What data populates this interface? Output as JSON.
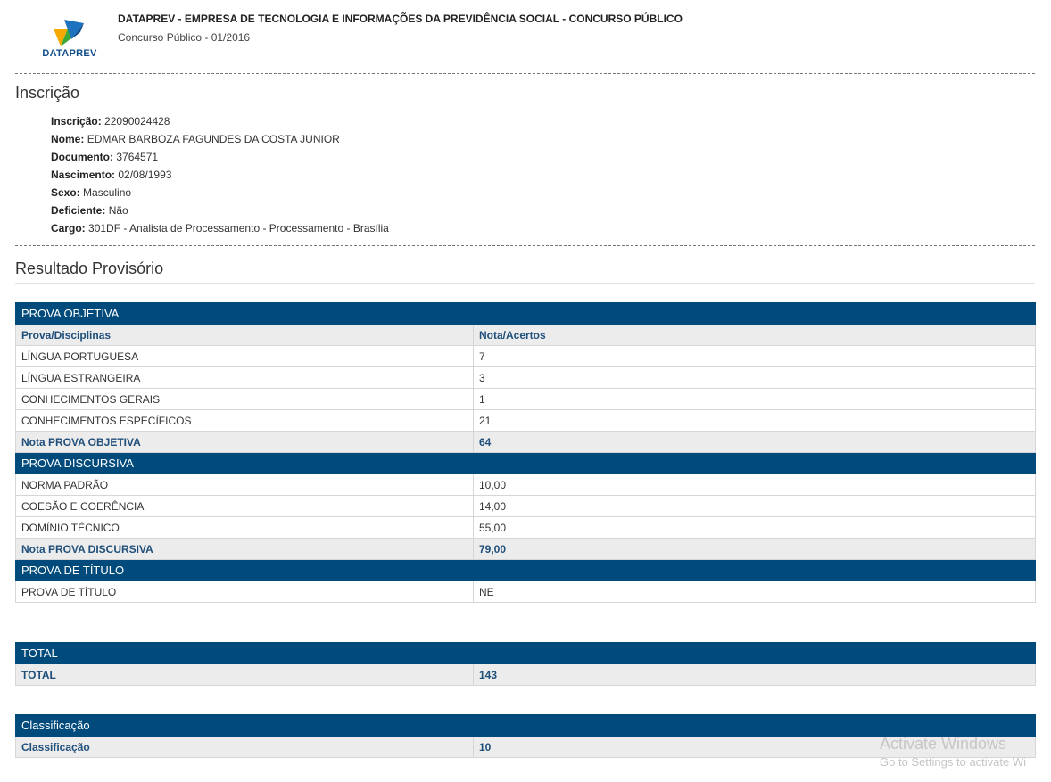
{
  "header": {
    "logo_text": "DATAPREV",
    "org_title": "DATAPREV - EMPRESA DE TECNOLOGIA E INFORMAÇÕES DA PREVIDÊNCIA SOCIAL - CONCURSO PÚBLICO",
    "org_subtitle": "Concurso Público - 01/2016"
  },
  "inscricao": {
    "title": "Inscrição",
    "fields": [
      {
        "label": "Inscrição:",
        "value": "22090024428"
      },
      {
        "label": "Nome:",
        "value": "EDMAR BARBOZA FAGUNDES DA COSTA JUNIOR"
      },
      {
        "label": "Documento:",
        "value": "3764571"
      },
      {
        "label": "Nascimento:",
        "value": "02/08/1993"
      },
      {
        "label": "Sexo:",
        "value": "Masculino"
      },
      {
        "label": "Deficiente:",
        "value": "Não"
      },
      {
        "label": "Cargo:",
        "value": "301DF - Analista de Processamento - Processamento - Brasília"
      }
    ]
  },
  "resultado": {
    "title": "Resultado Provisório",
    "objetiva": {
      "band": "PROVA OBJETIVA",
      "col1": "Prova/Disciplinas",
      "col2": "Nota/Acertos",
      "rows": [
        {
          "name": "LÍNGUA PORTUGUESA",
          "value": "7"
        },
        {
          "name": "LÍNGUA ESTRANGEIRA",
          "value": "3"
        },
        {
          "name": "CONHECIMENTOS GERAIS",
          "value": "1"
        },
        {
          "name": "CONHECIMENTOS ESPECÍFICOS",
          "value": "21"
        }
      ],
      "total_label": "Nota PROVA OBJETIVA",
      "total_value": "64"
    },
    "discursiva": {
      "band": "PROVA DISCURSIVA",
      "rows": [
        {
          "name": "NORMA PADRÃO",
          "value": "10,00"
        },
        {
          "name": "COESÃO E COERÊNCIA",
          "value": "14,00"
        },
        {
          "name": "DOMÍNIO TÉCNICO",
          "value": "55,00"
        }
      ],
      "total_label": "Nota PROVA DISCURSIVA",
      "total_value": "79,00"
    },
    "titulo": {
      "band": "PROVA DE TÍTULO",
      "rows": [
        {
          "name": "PROVA DE TÍTULO",
          "value": "NE"
        }
      ]
    },
    "total": {
      "band": "TOTAL",
      "label": "TOTAL",
      "value": "143"
    },
    "classificacao": {
      "band": "Classificação",
      "label": "Classificação",
      "value": "10"
    }
  },
  "watermark": {
    "line1": "Activate Windows",
    "line2": "Go to Settings to activate Wi"
  },
  "colors": {
    "band": "#004a7c",
    "summary_text": "#1f4f7a",
    "summary_bg": "#ececec"
  }
}
